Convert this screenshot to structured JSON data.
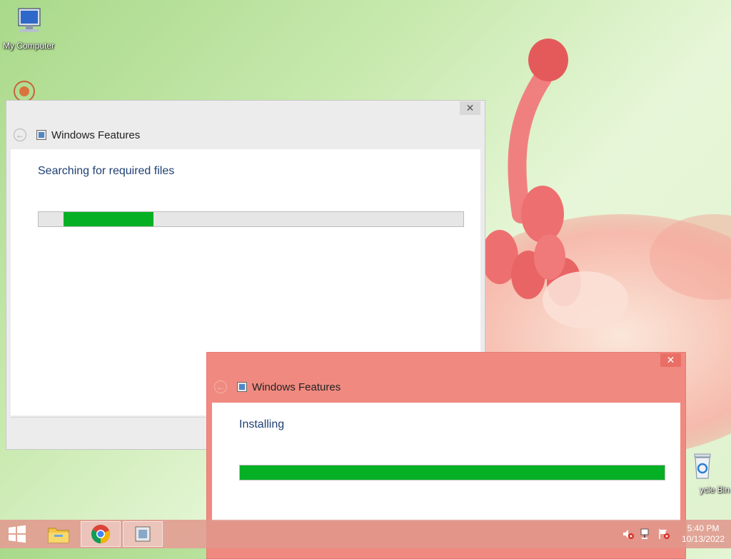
{
  "desktop": {
    "icons": [
      {
        "label": "My Computer",
        "icon": "computer-icon"
      },
      {
        "label": "ycle Bin",
        "icon": "recycle-bin-icon"
      }
    ]
  },
  "dialogs": [
    {
      "title": "Windows Features",
      "status_text": "Searching for required files",
      "close_symbol": "✕",
      "progress_marquee": {
        "start": 0.058,
        "end": 0.27
      }
    },
    {
      "title": "Windows Features",
      "status_text": "Installing",
      "close_symbol": "✕",
      "progress": 1.0
    }
  ],
  "taskbar": {
    "pinned": [
      "windows-start-icon",
      "file-explorer-icon",
      "chrome-icon",
      "windows-features-icon"
    ],
    "tray_icons": [
      "volume-muted-icon",
      "network-icon",
      "action-center-flag-icon"
    ],
    "clock": {
      "time": "5:40 PM",
      "date": "10/13/2022"
    }
  },
  "colors": {
    "progress_fill": "#06b025",
    "accent_window": "#f08a80",
    "heading": "#1e3f73"
  }
}
